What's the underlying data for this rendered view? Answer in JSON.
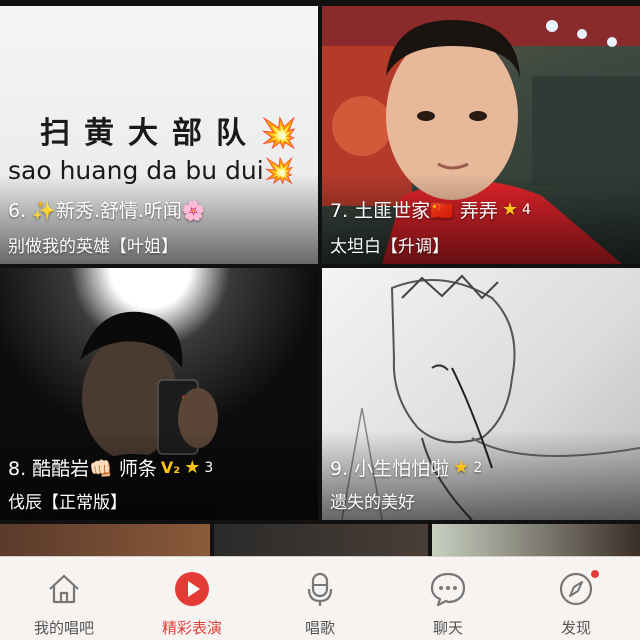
{
  "cards": [
    {
      "title": "6. ✨新秀.舒情.听闻🌸",
      "subtitle": "别做我的英雄【叶姐】",
      "cover_text_cn": "扫黄大部队💥",
      "cover_text_en": "sao huang da bu dui💥"
    },
    {
      "title": "7. 土匪世家🇨🇳 弄弄",
      "star_count": "4",
      "subtitle": "太坦白【升调】"
    },
    {
      "title": "8. 酷酷岩👊🏻 师条",
      "badge": "V₂",
      "star_count": "3",
      "subtitle": "伐辰【正常版】"
    },
    {
      "title": "9. 小生怕怕啦",
      "star_count": "2",
      "subtitle": "遗失的美好"
    }
  ],
  "tabs": [
    {
      "label": "我的唱吧",
      "icon": "home-icon",
      "active": false
    },
    {
      "label": "精彩表演",
      "icon": "play-icon",
      "active": true
    },
    {
      "label": "唱歌",
      "icon": "microphone-icon",
      "active": false
    },
    {
      "label": "聊天",
      "icon": "chat-icon",
      "active": false
    },
    {
      "label": "发现",
      "icon": "compass-icon",
      "active": false,
      "notification_dot": true
    }
  ],
  "colors": {
    "accent": "#e33c37",
    "star": "#ffc21a",
    "tabbar_bg": "#f7f3f1"
  }
}
